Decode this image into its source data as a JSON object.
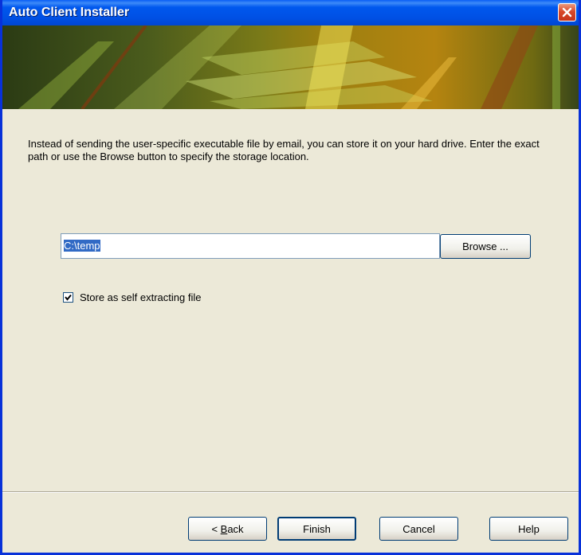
{
  "window": {
    "title": "Auto Client Installer"
  },
  "description": "Instead of sending the user-specific executable file by email, you can store it on your hard drive. Enter the exact path or use the Browse button to specify the storage location.",
  "path": {
    "value": "C:\\temp"
  },
  "buttons": {
    "browse": "Browse ...",
    "back_underlined": "B",
    "back_rest": "ack",
    "back_prefix": "< ",
    "finish": "Finish",
    "cancel": "Cancel",
    "help": "Help"
  },
  "checkbox": {
    "label": "Store as self extracting file",
    "checked": true
  },
  "colors": {
    "titlebar": "#0058ee",
    "background": "#ece9d8",
    "selection": "#316ac5",
    "close_button": "#d8492a"
  }
}
